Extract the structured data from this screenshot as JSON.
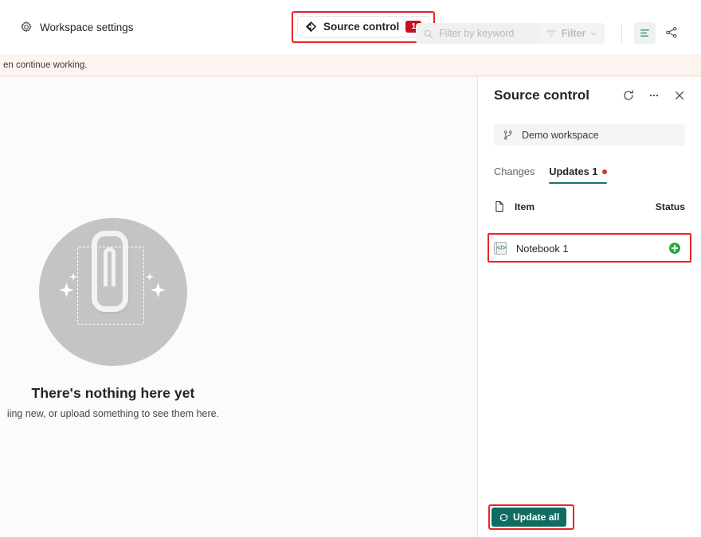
{
  "toolbar": {
    "workspace_settings_label": "Workspace settings",
    "workspace_settings_icon": "gear-icon",
    "source_control_label": "Source control",
    "source_control_badge": "1",
    "source_control_icon": "source-control-diamond-icon",
    "filter_placeholder": "Filter by keyword",
    "filter_search_icon": "search-icon",
    "filter_button_label": "Filter",
    "filter_button_icon": "filter-lines-icon",
    "filter_chevron_icon": "chevron-down-icon",
    "list_view_icon": "list-view-icon",
    "lineage_view_icon": "lineage-share-icon"
  },
  "banner": {
    "text": "en continue working."
  },
  "empty_state": {
    "illustration_icon": "paperclip-illustration",
    "title": "There's nothing here yet",
    "subtitle": "iing new, or upload something to see them here."
  },
  "panel": {
    "title": "Source control",
    "refresh_icon": "refresh-icon",
    "more_icon": "more-options-icon",
    "close_icon": "close-icon",
    "workspace": {
      "name": "Demo workspace",
      "icon": "git-branch-icon"
    },
    "tabs": [
      {
        "label": "Changes",
        "active": false,
        "has_dot": false
      },
      {
        "label": "Updates 1",
        "active": true,
        "has_dot": true
      }
    ],
    "columns": {
      "item_icon": "file-icon",
      "item_label": "Item",
      "status_label": "Status"
    },
    "rows": [
      {
        "name": "Notebook 1",
        "icon": "notebook-icon",
        "status_icon": "added-green-plus-icon"
      }
    ],
    "update_all": {
      "label": "Update all",
      "icon": "refresh-icon",
      "color": "#0f6c61"
    }
  },
  "colors": {
    "accent_teal": "#13756b",
    "highlight_red": "#e8232a",
    "badge_red": "#c50f1f",
    "status_green": "#27ac3e",
    "banner_bg": "#fdf3ef"
  }
}
